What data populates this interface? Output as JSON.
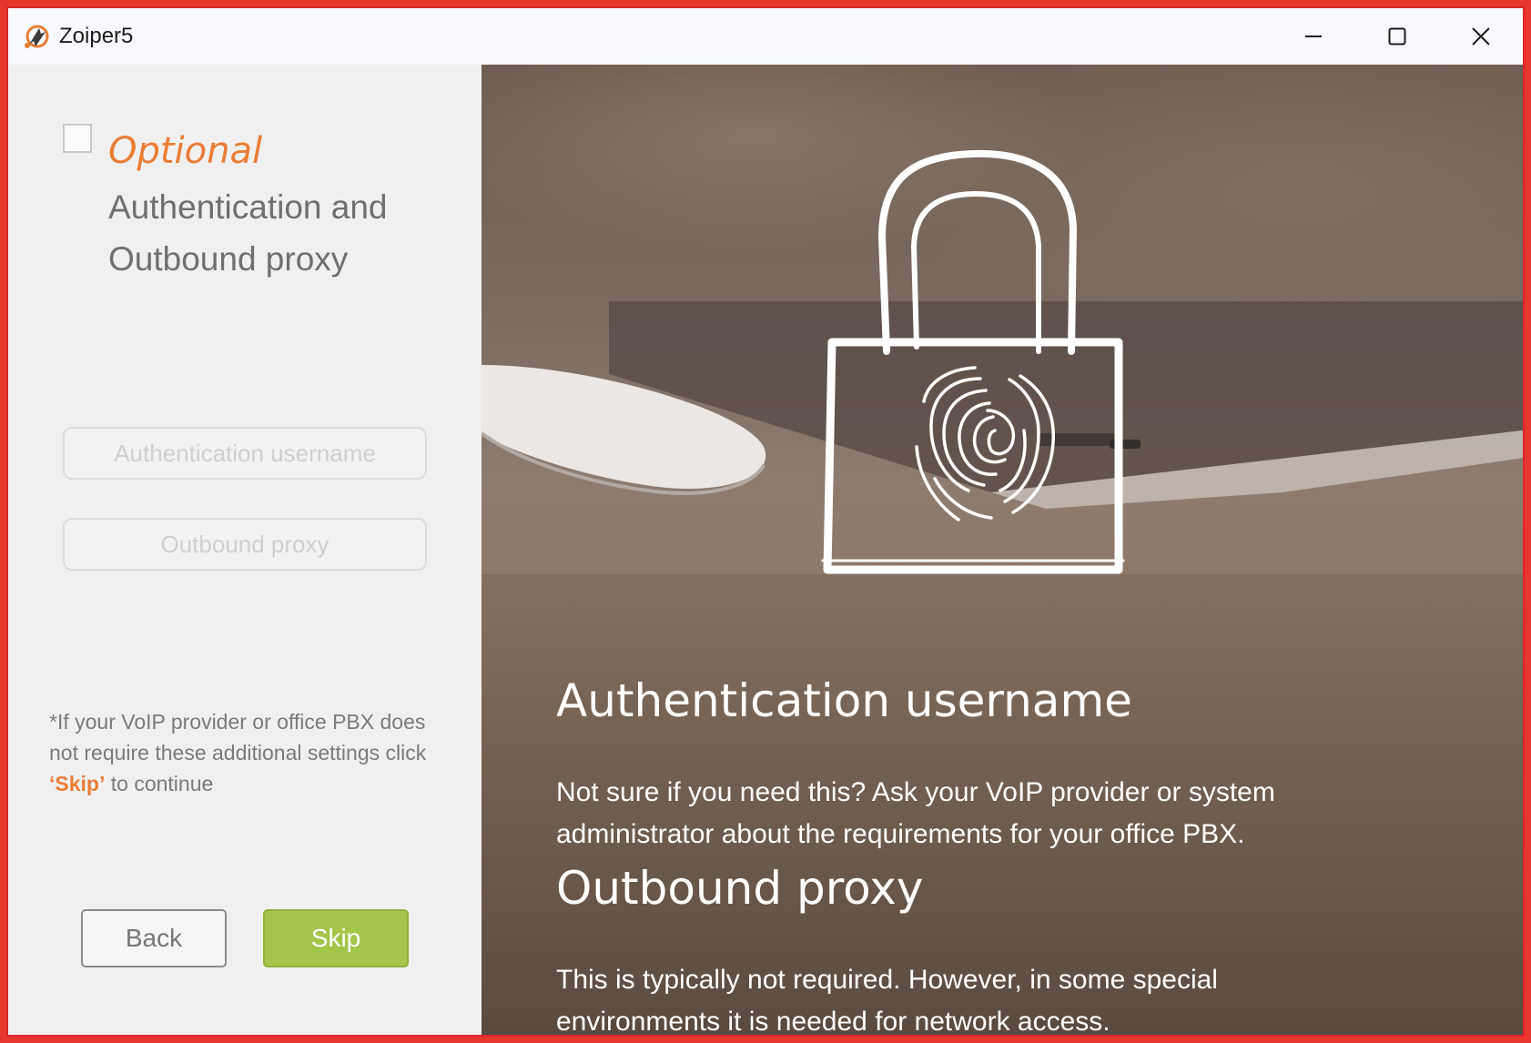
{
  "window": {
    "title": "Zoiper5",
    "icons": [
      "zoiper-logo-icon",
      "minimize-icon",
      "maximize-icon",
      "close-icon"
    ]
  },
  "left_panel": {
    "optional_label": "Optional",
    "subtitle": "Authentication and Outbound proxy",
    "auth_username_placeholder": "Authentication username",
    "outbound_proxy_placeholder": "Outbound proxy",
    "note_prefix": "*If your VoIP provider or office PBX does not require these additional settings click ",
    "note_skip": "‘Skip’",
    "note_suffix": " to continue",
    "back_label": "Back",
    "skip_label": "Skip"
  },
  "right_panel": {
    "auth_heading": "Authentication username",
    "auth_text": "Not sure if you need this? Ask your VoIP provider or system administrator about the requirements for your office PBX.",
    "proxy_heading": "Outbound proxy",
    "proxy_text": "This is typically not required. However, in some special environments it is needed for network access.",
    "illustration": "padlock-fingerprint-icon"
  },
  "colors": {
    "accent_orange": "#e97d36",
    "skip_green": "#a3c64a",
    "frame_red": "#e8362f"
  }
}
